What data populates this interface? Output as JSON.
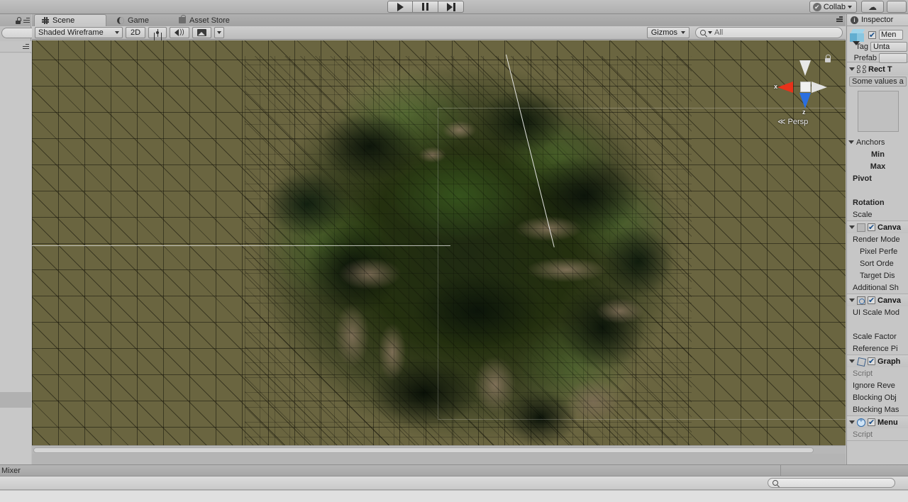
{
  "toolbar": {
    "play_label": "Play",
    "pause_label": "Pause",
    "step_label": "Step",
    "collab_label": "Collab",
    "collab_check_glyph": "✔",
    "cloud_glyph": "☁",
    "account_label": ""
  },
  "left_panel": {
    "lock_icon": "lock-icon",
    "menu_icon": "hamburger-menu-icon",
    "search_value": ""
  },
  "scene_panel": {
    "tabs": [
      {
        "label": "Scene",
        "icon": "grid-icon",
        "active": true
      },
      {
        "label": "Game",
        "icon": "moon-icon",
        "active": false
      },
      {
        "label": "Asset Store",
        "icon": "shopping-bag-icon",
        "active": false
      }
    ],
    "controls": {
      "draw_mode": "Shaded Wireframe",
      "two_d_label": "2D",
      "lighting_icon": "sun-icon",
      "audio_icon": "speaker-icon",
      "effects_icon": "image-icon",
      "effects_dropdown_glyph": "▾",
      "gizmos_label": "Gizmos",
      "search_placeholder": "All",
      "search_value": ""
    },
    "gizmo": {
      "x_label": "x",
      "z_label": "z",
      "projection": "Persp",
      "projection_arrow": "≪",
      "lock_icon": "lock-open-icon"
    }
  },
  "inspector": {
    "tab_label": "Inspector",
    "tab_icon": "info-icon",
    "object": {
      "enabled": true,
      "name": "Men",
      "tag_label": "Tag",
      "tag_value": "Unta",
      "prefab_label": "Prefab",
      "prefab_value": ""
    },
    "components": [
      {
        "title": "Rect T",
        "icon": "rect-transform-icon",
        "enabled": null,
        "expanded": true,
        "info": "Some values a",
        "has_rect_box": true,
        "rows": [
          {
            "label": "Anchors",
            "indent": 0,
            "bold": false,
            "foldout": true
          },
          {
            "label": "Min",
            "indent": 1,
            "bold": true
          },
          {
            "label": "Max",
            "indent": 1,
            "bold": true
          },
          {
            "label": "Pivot",
            "indent": 0,
            "bold": true
          },
          {
            "label": "",
            "indent": 0,
            "bold": false
          },
          {
            "label": "Rotation",
            "indent": 0,
            "bold": true
          },
          {
            "label": "Scale",
            "indent": 0,
            "bold": false
          }
        ]
      },
      {
        "title": "Canva",
        "icon": "canvas-icon",
        "enabled": true,
        "expanded": true,
        "rows": [
          {
            "label": "Render Mode",
            "indent": 0
          },
          {
            "label": "Pixel Perfe",
            "indent": 1
          },
          {
            "label": "Sort Orde",
            "indent": 1
          },
          {
            "label": "Target Dis",
            "indent": 1
          },
          {
            "label": "Additional Sh",
            "indent": 0
          }
        ]
      },
      {
        "title": "Canva",
        "icon": "canvas-scaler-icon",
        "enabled": true,
        "expanded": true,
        "rows": [
          {
            "label": "UI Scale Mod",
            "indent": 0
          },
          {
            "label": "",
            "indent": 0
          },
          {
            "label": "Scale Factor",
            "indent": 0
          },
          {
            "label": "Reference Pi",
            "indent": 0
          }
        ]
      },
      {
        "title": "Graph",
        "icon": "graphic-raycaster-icon",
        "enabled": true,
        "expanded": true,
        "rows": [
          {
            "label": "Script",
            "indent": 0,
            "dim": true
          },
          {
            "label": "Ignore Reve",
            "indent": 0
          },
          {
            "label": "Blocking Obj",
            "indent": 0
          },
          {
            "label": "Blocking Mas",
            "indent": 0
          }
        ]
      },
      {
        "title": "Menu",
        "icon": "script-icon",
        "enabled": true,
        "expanded": true,
        "rows": [
          {
            "label": "Script",
            "indent": 0,
            "dim": true
          }
        ]
      }
    ]
  },
  "bottom": {
    "tab_label": "Mixer",
    "search_placeholder": "",
    "search_value": ""
  }
}
